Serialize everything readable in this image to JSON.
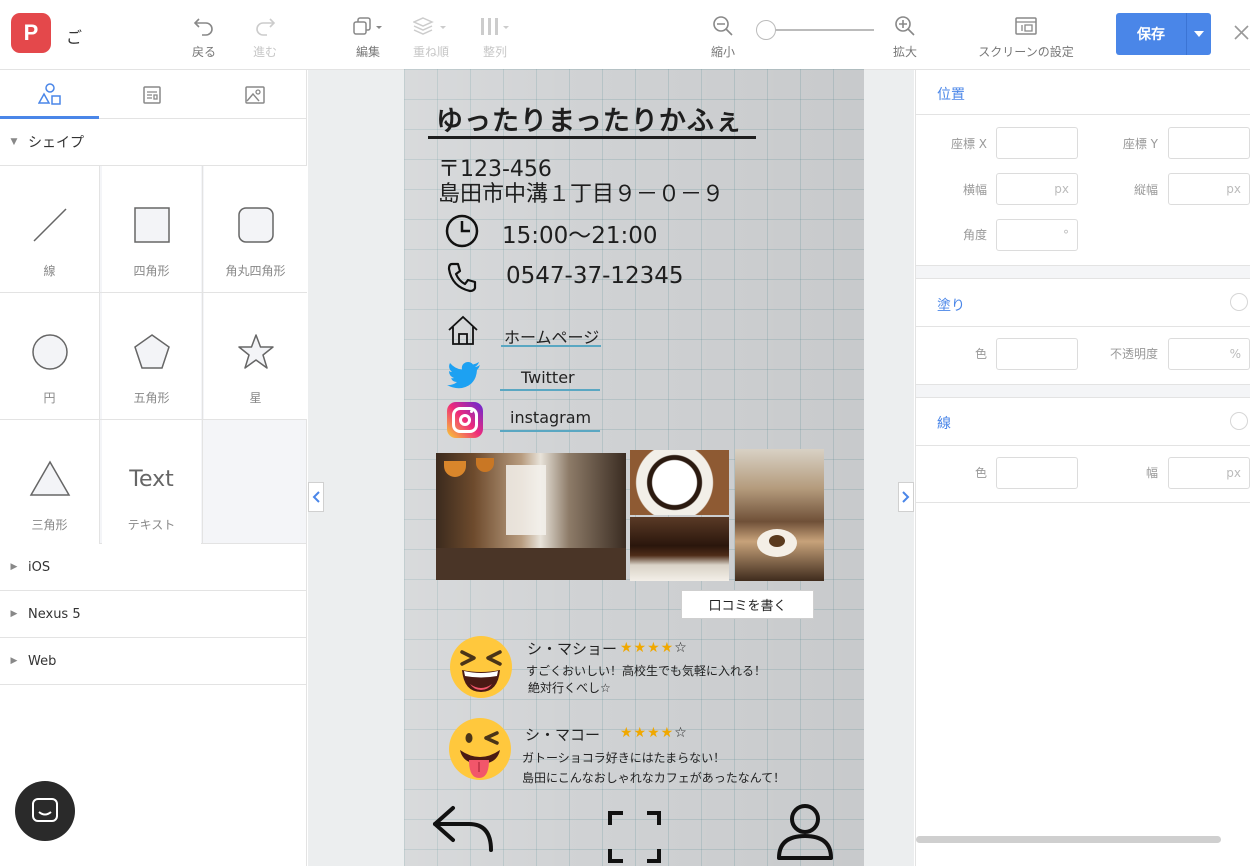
{
  "app": {
    "logo_letter": "P",
    "doc_title": "ご",
    "accent": "#4a86e8",
    "logo_color": "#e4484b"
  },
  "toolbar": {
    "undo": "戻る",
    "redo": "進む",
    "edit": "編集",
    "order": "重ね順",
    "align": "整列",
    "zoom_out": "縮小",
    "zoom_in": "拡大",
    "screen_settings": "スクリーンの設定",
    "save": "保存",
    "zoom_level": 0
  },
  "left_panel": {
    "tabs": [
      "shapes-icon",
      "template-icon",
      "image-icon"
    ],
    "shapes_section": "シェイプ",
    "shapes": [
      "線",
      "四角形",
      "角丸四角形",
      "円",
      "五角形",
      "星",
      "三角形",
      "テキスト"
    ],
    "text_shape_glyph": "Text",
    "device_sections": [
      "iOS",
      "Nexus 5",
      "Web"
    ]
  },
  "screen": {
    "title": "ゆったりまったりかふぇ",
    "postal": "〒123-456",
    "address": "島田市中溝１丁目９－０－９",
    "hours": "15:00～21:00",
    "phone": "0547-37-12345",
    "links": [
      "ホームページ",
      "Twitter",
      "instagram"
    ],
    "review_button": "口コミを書く",
    "reviews": [
      {
        "name": "シ・マショー",
        "stars_filled": 4,
        "stars_empty": "☆",
        "stars_text": "★★★★",
        "line1": "すごくおいしい！高校生でも気軽に入れる！",
        "line2": "絶対行くべし☆"
      },
      {
        "name": "シ・マコー",
        "stars_filled": 4,
        "stars_empty": "☆",
        "stars_text": "★★★★",
        "line1": "ガトーショコラ好きにはたまらない！",
        "line2": "島田にこんなおしゃれなカフェがあったなんて！"
      }
    ]
  },
  "right_panel": {
    "position": {
      "heading": "位置",
      "x": "座標 X",
      "y": "座標 Y",
      "width": "横幅",
      "height": "縦幅",
      "angle": "角度",
      "unit_px": "px",
      "unit_deg": "°"
    },
    "fill": {
      "heading": "塗り",
      "color": "色",
      "opacity": "不透明度",
      "unit_pct": "%"
    },
    "stroke": {
      "heading": "線",
      "color": "色",
      "width": "幅",
      "unit_px": "px"
    }
  }
}
